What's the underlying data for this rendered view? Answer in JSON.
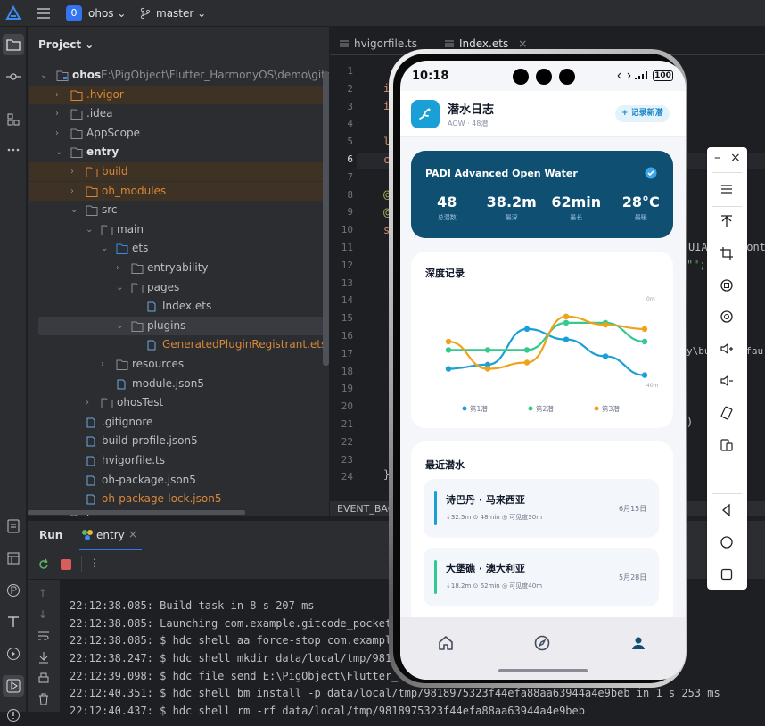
{
  "toolbar": {
    "project_badge": "0",
    "project_name": "ohos",
    "branch": "master"
  },
  "project_panel": {
    "title": "Project",
    "root_name": "ohos",
    "root_path": "E:\\PigObject\\Flutter_HarmonyOS\\demo\\gitcode_p",
    "tree": [
      {
        "label": ".hvigor",
        "type": "folder",
        "expanded": false,
        "excluded": true
      },
      {
        "label": ".idea",
        "type": "folder",
        "expanded": false
      },
      {
        "label": "AppScope",
        "type": "folder",
        "expanded": false
      },
      {
        "label": "entry",
        "type": "module",
        "expanded": true
      },
      {
        "label": "build",
        "type": "folder",
        "expanded": false,
        "excluded": true
      },
      {
        "label": "oh_modules",
        "type": "folder",
        "expanded": false,
        "excluded": true
      },
      {
        "label": "src",
        "type": "folder",
        "expanded": true
      },
      {
        "label": "main",
        "type": "folder",
        "expanded": true
      },
      {
        "label": "ets",
        "type": "folder",
        "expanded": true
      },
      {
        "label": "entryability",
        "type": "folder",
        "expanded": false
      },
      {
        "label": "pages",
        "type": "folder",
        "expanded": true
      },
      {
        "label": "Index.ets",
        "type": "file"
      },
      {
        "label": "plugins",
        "type": "folder",
        "expanded": true
      },
      {
        "label": "GeneratedPluginRegistrant.ets",
        "type": "file"
      },
      {
        "label": "resources",
        "type": "folder",
        "expanded": false
      },
      {
        "label": "module.json5",
        "type": "file"
      },
      {
        "label": "ohosTest",
        "type": "folder",
        "expanded": false
      },
      {
        "label": ".gitignore",
        "type": "file"
      },
      {
        "label": "build-profile.json5",
        "type": "file"
      },
      {
        "label": "hvigorfile.ts",
        "type": "file"
      },
      {
        "label": "oh-package.json5",
        "type": "file"
      },
      {
        "label": "oh-package-lock.json5",
        "type": "file"
      },
      {
        "label": "hvigor",
        "type": "folder",
        "expanded": false
      }
    ]
  },
  "editor": {
    "tabs": [
      "hvigorfile.ts",
      "Index.ets"
    ],
    "line_numbers": [
      "1",
      "2",
      "3",
      "4",
      "5",
      "6",
      "7",
      "8",
      "9",
      "10",
      "11",
      "12",
      "13",
      "14",
      "15",
      "16",
      "17",
      "18",
      "19",
      "20",
      "21",
      "22",
      "23",
      "24"
    ],
    "current_line": "6",
    "code_fragments": {
      "l2": "i",
      "l3": "i",
      "l5": "l",
      "l6": "c",
      "l8": "@",
      "l9": "@",
      "l10": "s",
      "l11": "UIA",
      "l11b": "Cont",
      "l12": "\"\";",
      "l17": "y\\build\\defau",
      "l22": ")",
      "l24": "}"
    },
    "status_bar": "EVENT_BAC"
  },
  "run_panel": {
    "tab_run": "Run",
    "tab_entry": "entry",
    "console_lines": [
      "22:12:38.085: Build task in 8 s 207 ms",
      "22:12:38.085: Launching com.example.gitcode_pocket",
      "22:12:38.085: $ hdc shell aa force-stop com.exampl",
      "22:12:38.247: $ hdc shell mkdir data/local/tmp/981",
      "22:12:39.098: $ hdc file send E:\\PigObject\\Flutter_",
      "22:12:40.351: $ hdc shell bm install -p data/local/tmp/9818975323f44efa88aa63944a4e9beb in 1 s 253 ms",
      "22:12:40.437: $ hdc shell rm -rf data/local/tmp/9818975323f44efa88aa63944a4e9beb"
    ]
  },
  "phone": {
    "status_time": "10:18",
    "battery": "100",
    "app_title": "潜水日志",
    "app_subtitle": "AOW · 48潜",
    "new_record_button": "+ 记录新潜",
    "cert_card": {
      "title": "PADI Advanced Open Water",
      "stats": [
        {
          "value": "48",
          "label": "总潜数"
        },
        {
          "value": "38.2m",
          "label": "最深"
        },
        {
          "value": "62min",
          "label": "最长"
        },
        {
          "value": "28°C",
          "label": "最暖"
        }
      ]
    },
    "depth_section_title": "深度记录",
    "recent_section_title": "最近潜水",
    "recent_dives": [
      {
        "site": "诗巴丹 · 马来西亚",
        "depth": "↓32.5m",
        "time": "48min",
        "vis": "可见度30m",
        "date": "6月15日",
        "accent": "#1a9fd6"
      },
      {
        "site": "大堡礁 · 澳大利亚",
        "depth": "↓18.2m",
        "time": "62min",
        "vis": "可见度40m",
        "date": "5月28日",
        "accent": "#34c98e"
      }
    ],
    "nav": [
      "home-icon",
      "compass-icon",
      "profile-icon"
    ]
  },
  "chart_data": {
    "type": "line",
    "title": "深度记录",
    "y_top_label": "0m",
    "y_bottom_label": "40m",
    "ylim": [
      0,
      40
    ],
    "x": [
      0,
      1,
      2,
      3,
      4,
      5
    ],
    "series": [
      {
        "name": "第1潜",
        "color": "#1a9fd6",
        "points": [
          [
            0,
            33
          ],
          [
            1,
            31
          ],
          [
            2,
            14
          ],
          [
            3,
            19
          ],
          [
            4,
            27
          ],
          [
            5,
            36
          ]
        ]
      },
      {
        "name": "第2潜",
        "color": "#34c98e",
        "points": [
          [
            0,
            24
          ],
          [
            1,
            24
          ],
          [
            2,
            24
          ],
          [
            3,
            11
          ],
          [
            4,
            11
          ],
          [
            5,
            20
          ]
        ]
      },
      {
        "name": "第3潜",
        "color": "#f0a21a",
        "points": [
          [
            0,
            20
          ],
          [
            1,
            33
          ],
          [
            2,
            30
          ],
          [
            3,
            8
          ],
          [
            4,
            12
          ],
          [
            5,
            14
          ]
        ]
      }
    ],
    "legend_position": "bottom"
  },
  "emulator": {
    "buttons": [
      "minimize-icon",
      "close-icon",
      "menu-icon",
      "rotate-up-icon",
      "crop-icon",
      "screenshot-icon",
      "record-icon",
      "volume-up-icon",
      "volume-down-icon",
      "rotate-device-icon",
      "fold-icon",
      "back-icon",
      "home-icon",
      "overview-icon"
    ]
  }
}
